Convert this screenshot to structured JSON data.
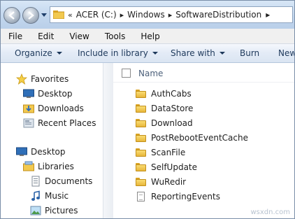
{
  "address_bar": {
    "overflow_chevron": "«",
    "crumbs": [
      "ACER (C:)",
      "Windows",
      "SoftwareDistribution"
    ],
    "separator": "▸"
  },
  "menu": [
    "File",
    "Edit",
    "View",
    "Tools",
    "Help"
  ],
  "commands": {
    "organize": "Organize",
    "include_in_library": "Include in library",
    "share_with": "Share with",
    "burn": "Burn",
    "new_folder": "New"
  },
  "nav_pane": {
    "favorites": "Favorites",
    "desktop": "Desktop",
    "downloads": "Downloads",
    "recent_places": "Recent Places",
    "desktop_root": "Desktop",
    "libraries": "Libraries",
    "documents": "Documents",
    "music": "Music",
    "pictures": "Pictures"
  },
  "file_list": {
    "column_name": "Name",
    "folders": [
      "AuthCabs",
      "DataStore",
      "Download",
      "PostRebootEventCache",
      "ScanFile",
      "SelfUpdate",
      "WuRedir"
    ],
    "files": [
      "ReportingEvents"
    ]
  },
  "watermark": "wsxdn.com",
  "colors": {
    "accent_bar": "#c3d7ee",
    "command_text": "#1e395b",
    "folder": "#e8b73b"
  }
}
